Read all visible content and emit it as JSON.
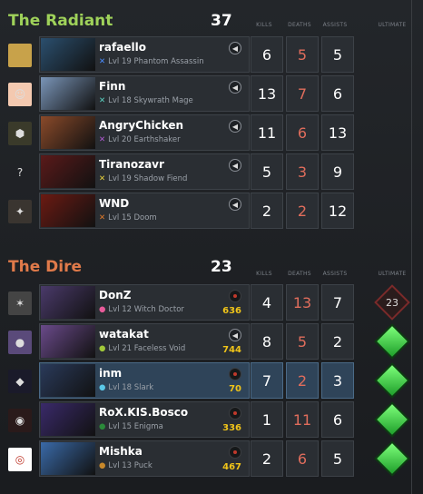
{
  "header_labels": {
    "kills": "KILLS",
    "deaths": "DEATHS",
    "assists": "ASSISTS",
    "ultimate": "ULTIMATE"
  },
  "radiant": {
    "title": "The Radiant",
    "score": "37",
    "players": [
      {
        "name": "rafaello",
        "hero": "Phantom Assassin",
        "level": "Lvl 19",
        "kills": "6",
        "deaths": "5",
        "assists": "5",
        "mark_color": "#4a8cff",
        "avatar_icon": "gold-texture",
        "portrait_color": "#2b4f6e"
      },
      {
        "name": "Finn",
        "hero": "Skywrath Mage",
        "level": "Lvl 18",
        "kills": "13",
        "deaths": "7",
        "assists": "6",
        "mark_color": "#5bd3c2",
        "avatar_icon": "finn-face",
        "portrait_color": "#7a95b8"
      },
      {
        "name": "AngryChicken",
        "hero": "Earthshaker",
        "level": "Lvl 20",
        "kills": "11",
        "deaths": "6",
        "assists": "13",
        "mark_color": "#b05bd3",
        "avatar_icon": "shield-emblem",
        "portrait_color": "#8a4a2a"
      },
      {
        "name": "Tiranozavr",
        "hero": "Shadow Fiend",
        "level": "Lvl 19",
        "kills": "5",
        "deaths": "3",
        "assists": "9",
        "mark_color": "#e8d23a",
        "avatar_icon": "question-mark",
        "portrait_color": "#5a1a1a"
      },
      {
        "name": "WND",
        "hero": "Doom",
        "level": "Lvl 15",
        "kills": "2",
        "deaths": "2",
        "assists": "12",
        "mark_color": "#e07a2a",
        "avatar_icon": "fox-face",
        "portrait_color": "#6b1a12"
      }
    ]
  },
  "dire": {
    "title": "The Dire",
    "score": "23",
    "players": [
      {
        "name": "DonZ",
        "hero": "Witch Doctor",
        "level": "Lvl 12",
        "gold": "636",
        "kills": "4",
        "deaths": "13",
        "assists": "7",
        "ult": "23",
        "mark_color": "#e85b9a",
        "avatar_icon": "graffiti",
        "portrait_color": "#4a3a6a"
      },
      {
        "name": "watakat",
        "hero": "Faceless Void",
        "level": "Lvl 21",
        "gold": "744",
        "kills": "8",
        "deaths": "5",
        "assists": "2",
        "ult": "",
        "mark_color": "#a0c83a",
        "avatar_icon": "creature-face",
        "portrait_color": "#6a4a8a"
      },
      {
        "name": "inm",
        "hero": "Slark",
        "level": "Lvl 18",
        "gold": "70",
        "kills": "7",
        "deaths": "2",
        "assists": "3",
        "ult": "",
        "mark_color": "#5bc8e8",
        "avatar_icon": "dark-figure",
        "portrait_color": "#2a3a5a"
      },
      {
        "name": "RoX.KIS.Bosco",
        "hero": "Enigma",
        "level": "Lvl 15",
        "gold": "336",
        "kills": "1",
        "deaths": "11",
        "assists": "6",
        "ult": "",
        "mark_color": "#2a8a3a",
        "avatar_icon": "dark-mask",
        "portrait_color": "#3a2a6a"
      },
      {
        "name": "Mishka",
        "hero": "Puck",
        "level": "Lvl 13",
        "gold": "467",
        "kills": "2",
        "deaths": "6",
        "assists": "5",
        "ult": "",
        "mark_color": "#c8882a",
        "avatar_icon": "red-eye",
        "portrait_color": "#3a6aa8"
      }
    ]
  }
}
